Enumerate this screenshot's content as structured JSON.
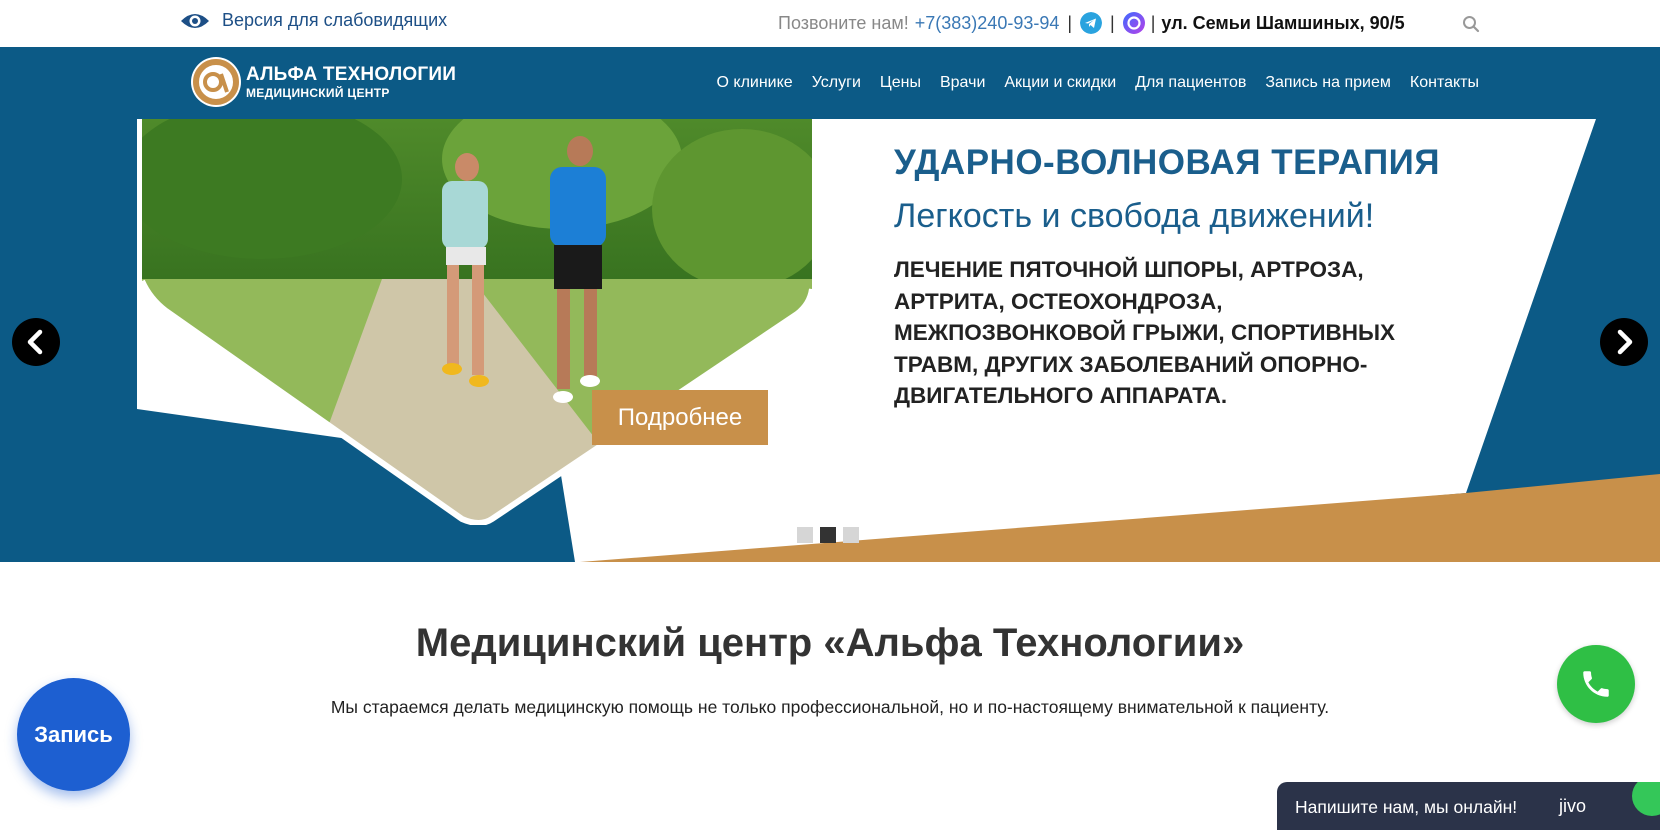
{
  "topbar": {
    "low_vision_label": "Версия для слабовидящих",
    "call_label": "Позвоните нам!",
    "phone": "+7(383)240-93-94",
    "separator": "|",
    "address": "ул. Семьи Шамшиных, 90/5",
    "icons": [
      "eye-icon",
      "telegram-icon",
      "max-messenger-icon",
      "search-icon"
    ]
  },
  "logo": {
    "line1": "АЛЬФА ТЕХНОЛОГИИ",
    "line2": "МЕДИЦИНСКИЙ ЦЕНТР"
  },
  "nav": {
    "items": [
      "О клинике",
      "Услуги",
      "Цены",
      "Врачи",
      "Акции и скидки",
      "Для пациентов",
      "Запись на прием",
      "Контакты"
    ]
  },
  "slider": {
    "title": "УДАРНО-ВОЛНОВАЯ ТЕРАПИЯ",
    "subtitle": "Легкость и свобода движений!",
    "description": "ЛЕЧЕНИЕ ПЯТОЧНОЙ ШПОРЫ, АРТРОЗА, АРТРИТА, ОСТЕОХОНДРОЗА, МЕЖПОЗВОНКОВОЙ ГРЫЖИ, СПОРТИВНЫХ ТРАВМ, ДРУГИХ ЗАБОЛЕВАНИЙ ОПОРНО-ДВИГАТЕЛЬНОГО АППАРАТА.",
    "button_label": "Подробнее",
    "slide_count": 3,
    "active_slide": 2
  },
  "main": {
    "title": "Медицинский центр «Альфа Технологии»",
    "subtitle": "Мы стараемся делать медицинскую помощь не только профессиональной, но и по-настоящему внимательной к пациенту."
  },
  "widgets": {
    "appointment_label": "Запись",
    "chat_label": "Напишите нам, мы онлайн!",
    "chat_brand": "jivo"
  },
  "colors": {
    "brand_blue": "#0c5a86",
    "accent_gold": "#c8904a",
    "appointment_blue": "#1d5fd1",
    "call_green": "#2fbf45",
    "chat_dark": "#2b3349"
  }
}
